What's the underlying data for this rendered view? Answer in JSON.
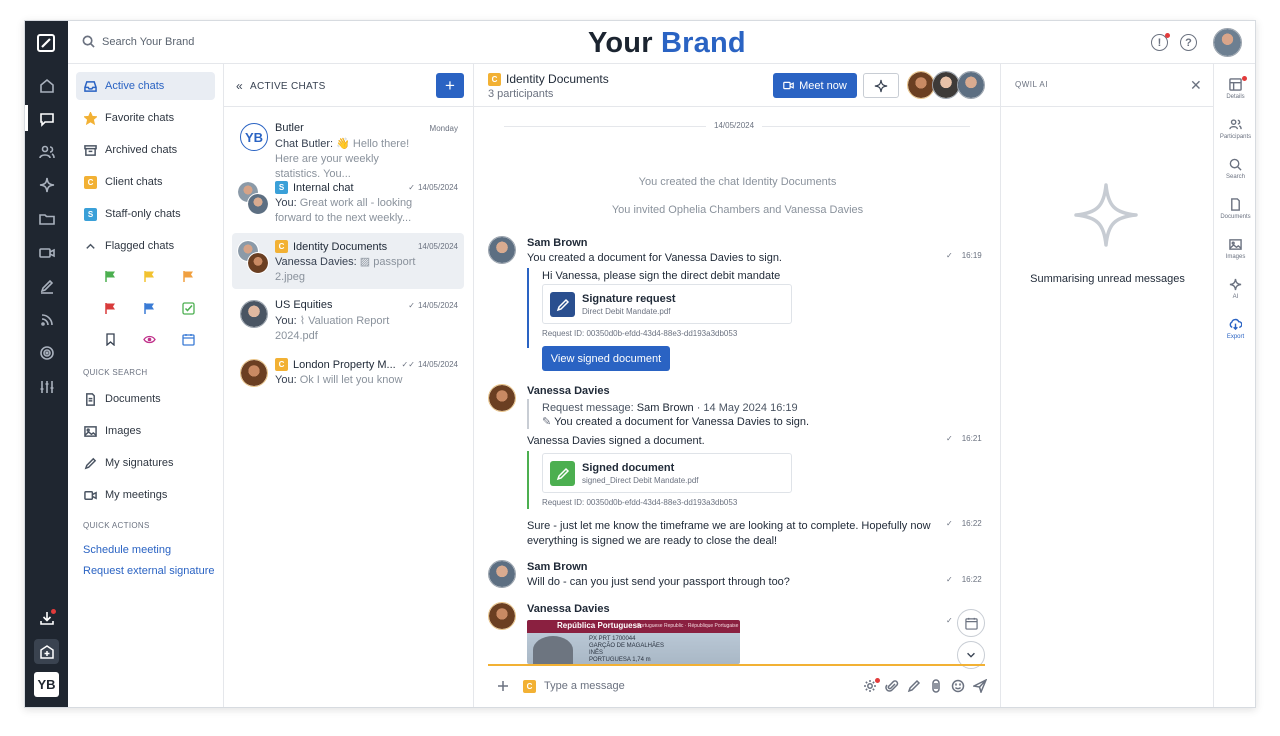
{
  "brand": {
    "part1": "Your",
    "part2": "Brand"
  },
  "search": {
    "placeholder": "Search Your Brand"
  },
  "rail": {
    "logo_initials": "YB"
  },
  "nav": {
    "items": [
      {
        "label": "Active chats"
      },
      {
        "label": "Favorite chats"
      },
      {
        "label": "Archived chats"
      },
      {
        "label": "Client chats",
        "tag": "C"
      },
      {
        "label": "Staff-only chats",
        "tag": "S"
      },
      {
        "label": "Flagged chats"
      }
    ],
    "quick_search_heading": "QUICK SEARCH",
    "quick_search": [
      {
        "label": "Documents"
      },
      {
        "label": "Images"
      },
      {
        "label": "My signatures"
      },
      {
        "label": "My meetings"
      }
    ],
    "quick_actions_heading": "QUICK ACTIONS",
    "quick_actions": [
      {
        "label": "Schedule meeting"
      },
      {
        "label": "Request external signature"
      }
    ]
  },
  "chat_list": {
    "title": "ACTIVE CHATS",
    "add_label": "+",
    "chats": [
      {
        "name": "Butler",
        "avatar": "YB",
        "date": "Monday",
        "preview_sender": "Chat Butler: ",
        "preview": "👋 Hello there! Here are your weekly statistics. You..."
      },
      {
        "name": "Internal chat",
        "tag": "S",
        "date": "14/05/2024",
        "preview_sender": "You: ",
        "preview": "Great work all - looking forward to the next weekly..."
      },
      {
        "name": "Identity Documents",
        "tag": "C",
        "date": "14/05/2024",
        "preview_sender": "Vanessa Davies: ",
        "preview": "passport 2.jpeg"
      },
      {
        "name": "US Equities",
        "date": "14/05/2024",
        "preview_sender": "You: ",
        "preview": "Valuation Report 2024.pdf"
      },
      {
        "name": "London Property M...",
        "tag": "C",
        "date": "14/05/2024",
        "preview_sender": "You: ",
        "preview": "Ok I will let you know"
      }
    ]
  },
  "conversation": {
    "title": "Identity Documents",
    "tag": "C",
    "participants": "3 participants",
    "meet_now": "Meet now",
    "day": "14/05/2024",
    "system": [
      "You created the chat Identity Documents",
      "You invited Ophelia Chambers and Vanessa Davies"
    ],
    "messages": {
      "m1": {
        "sender": "Sam Brown",
        "text": "You created a document for Vanessa Davies to sign.",
        "time": "16:19",
        "note": "Hi Vanessa, please sign the direct debit mandate",
        "doc_title": "Signature request",
        "doc_file": "Direct Debit Mandate.pdf",
        "request_id": "Request ID: 00350d0b-efdd-43d4-88e3-dd193a3db053",
        "button": "View signed document"
      },
      "m2": {
        "sender": "Vanessa Davies",
        "request_label": "Request message: ",
        "request_from": "Sam Brown",
        "request_date": "· 14 May 2024 16:19",
        "quoted": "You created a document for Vanessa Davies to sign.",
        "text": "Vanessa Davies signed a document.",
        "time": "16:21",
        "doc_title": "Signed document",
        "doc_file": "signed_Direct Debit Mandate.pdf",
        "request_id": "Request ID: 00350d0b-efdd-43d4-88e3-dd193a3db053"
      },
      "m3": {
        "text1": "Sure - just let me know the timeframe we are looking at to complete. Hopefully now",
        "text2": "everything is signed we are ready to close the deal!",
        "time": "16:22"
      },
      "m4": {
        "sender": "Sam Brown",
        "text": "Will do - can you just send your passport through too?",
        "time": "16:22"
      },
      "m5": {
        "sender": "Vanessa Davies",
        "passport_header": "República Portuguesa",
        "passport_sub": "Portuguese Republic · République Portugaise",
        "passport_lines": [
          "PX     PRT     1700044",
          "GARÇÃO DE MAGALHÃES",
          "INÊS",
          "PORTUGUESA          1,74 m"
        ]
      }
    },
    "composer_placeholder": "Type a message",
    "composer_tag": "C"
  },
  "ai_panel": {
    "title": "QWIL AI",
    "status": "Summarising unread messages"
  },
  "right_rail": [
    {
      "label": "Details",
      "icon": "details-icon"
    },
    {
      "label": "Participants",
      "icon": "participants-icon"
    },
    {
      "label": "Search",
      "icon": "search-icon"
    },
    {
      "label": "Documents",
      "icon": "document-icon"
    },
    {
      "label": "Images",
      "icon": "image-icon"
    },
    {
      "label": "AI",
      "icon": "sparkle-icon"
    },
    {
      "label": "Export",
      "icon": "export-icon"
    }
  ],
  "colors": {
    "accent": "#2a63c3",
    "client_tag": "#f2b134",
    "staff_tag": "#3aa0d8",
    "rail": "#1f2630",
    "signed_green": "#4caf50",
    "notification": "#e23b3b"
  }
}
